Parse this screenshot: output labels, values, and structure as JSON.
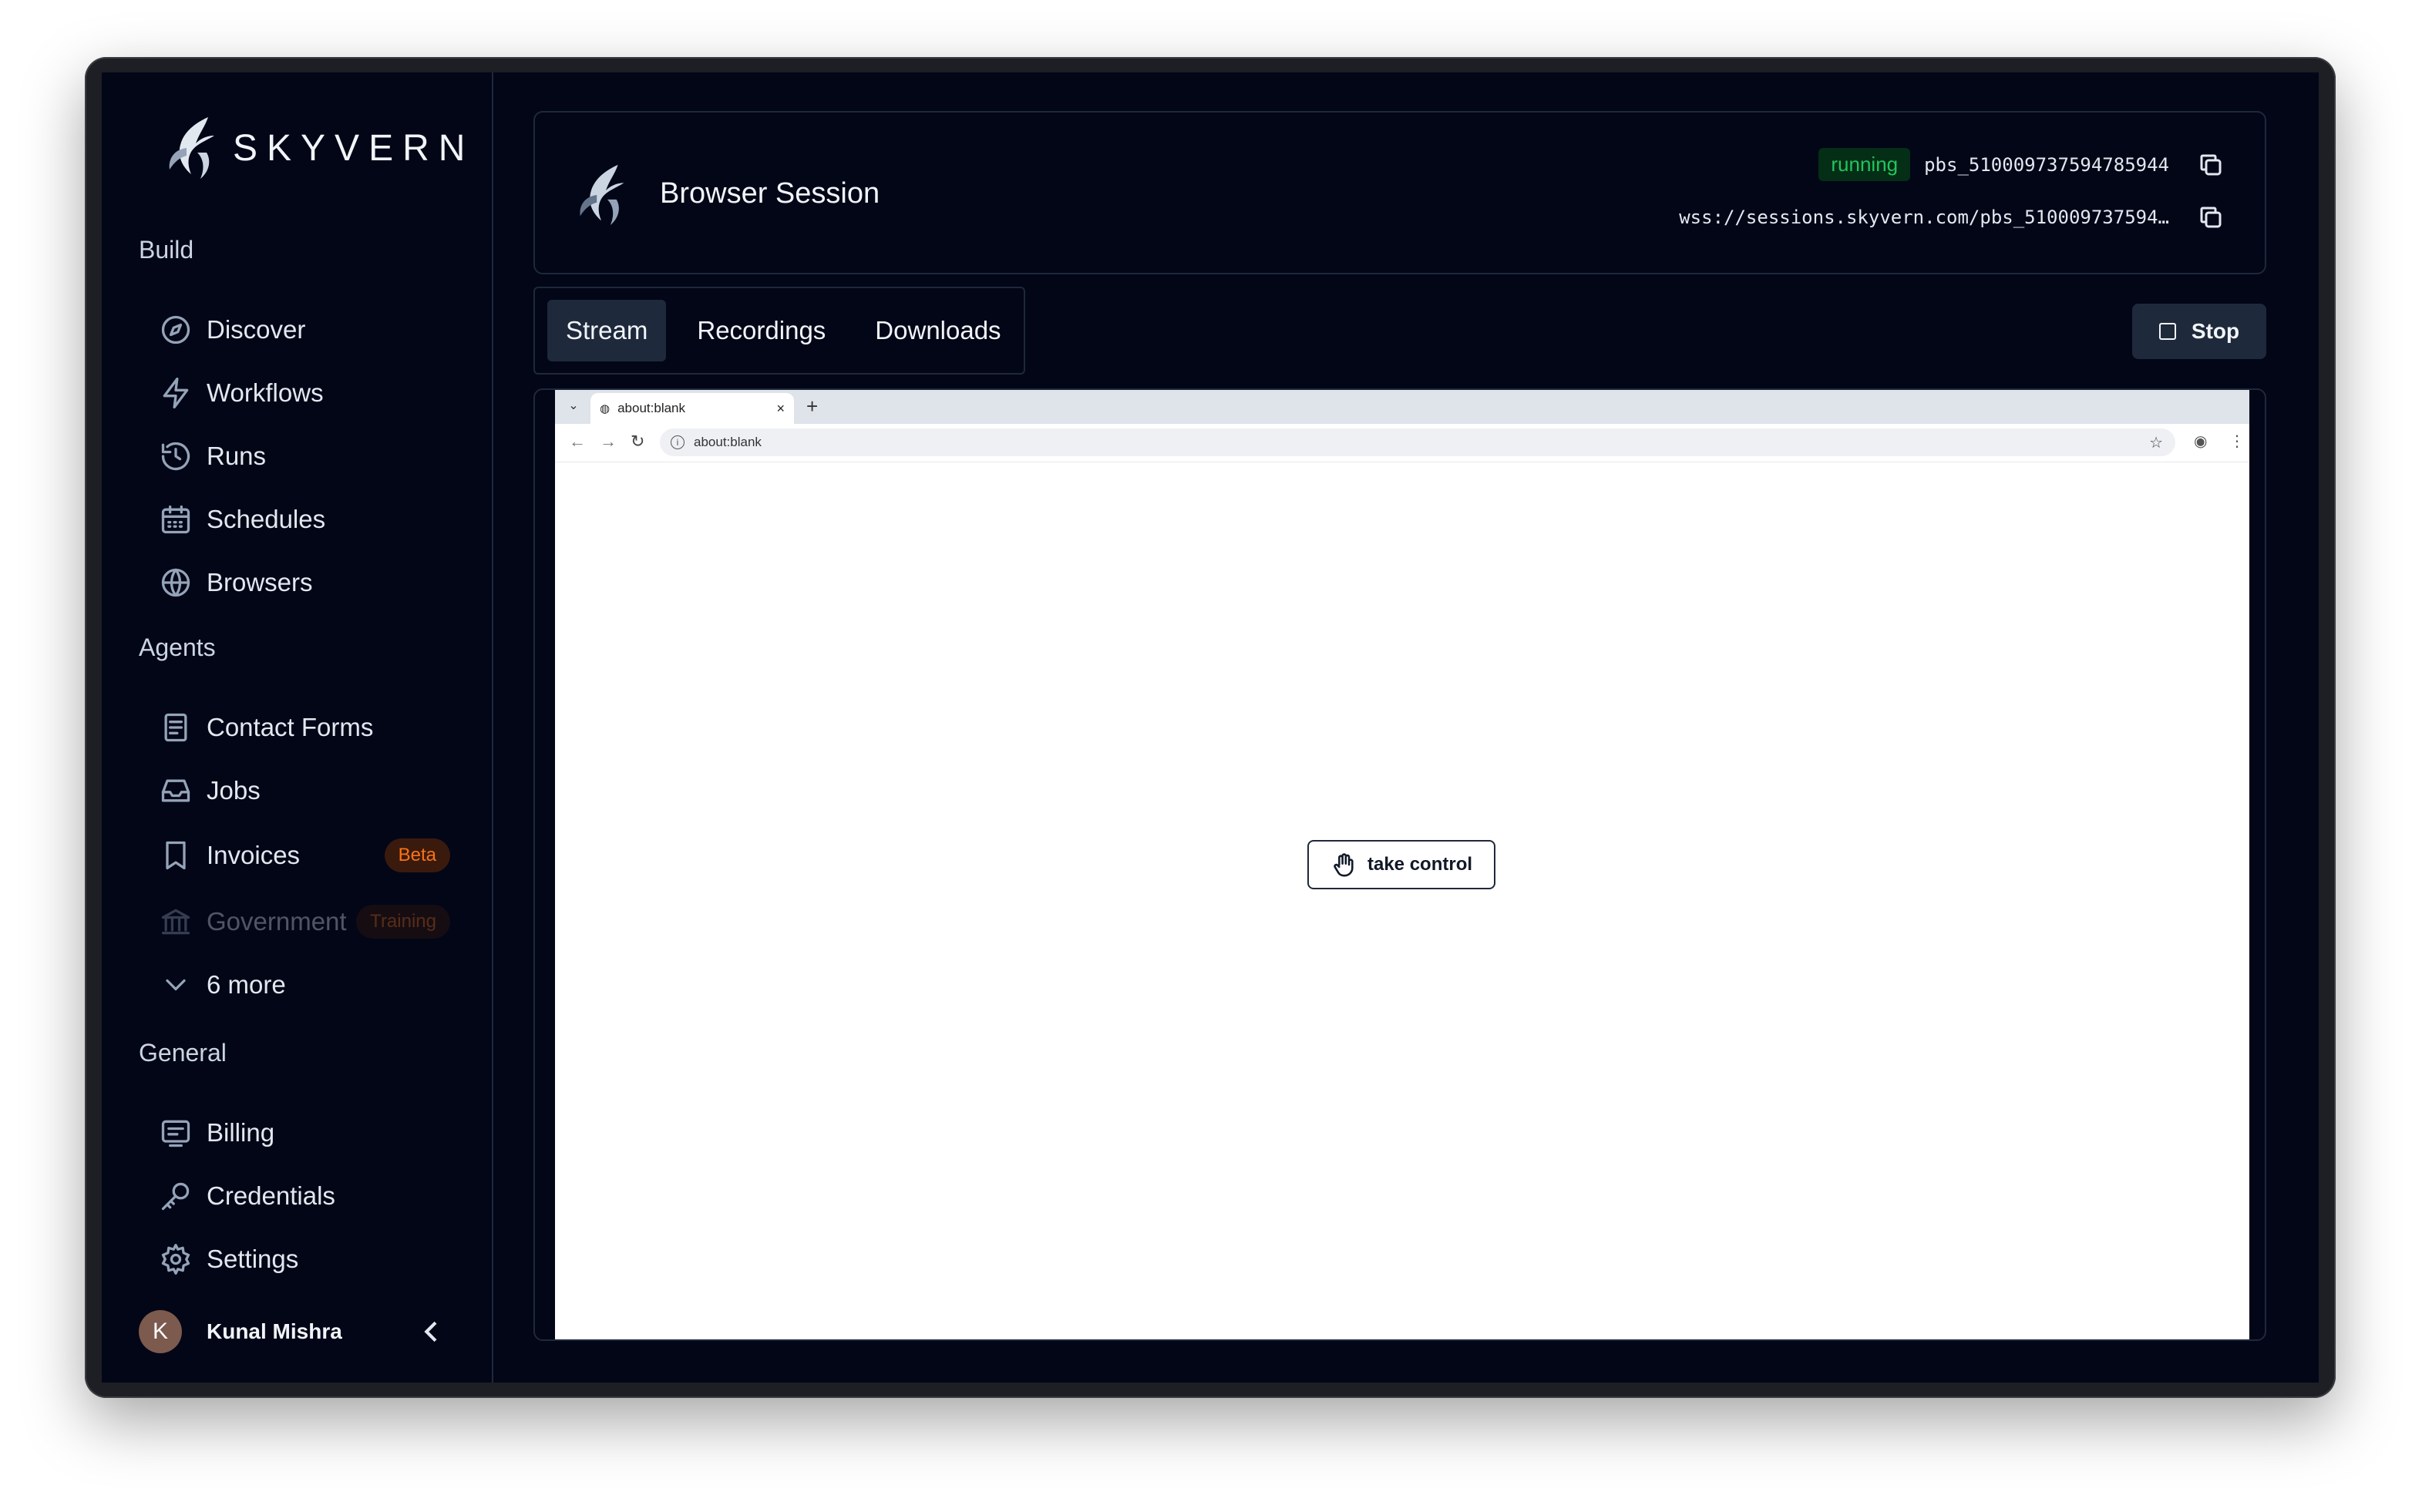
{
  "brand": {
    "name": "SKYVERN"
  },
  "sidebar": {
    "sections": [
      {
        "title": "Build",
        "items": [
          {
            "label": "Discover",
            "icon": "compass-icon"
          },
          {
            "label": "Workflows",
            "icon": "lightning-icon"
          },
          {
            "label": "Runs",
            "icon": "history-icon"
          },
          {
            "label": "Schedules",
            "icon": "calendar-icon"
          },
          {
            "label": "Browsers",
            "icon": "globe-icon"
          }
        ]
      },
      {
        "title": "Agents",
        "items": [
          {
            "label": "Contact Forms",
            "icon": "document-icon"
          },
          {
            "label": "Jobs",
            "icon": "inbox-icon"
          },
          {
            "label": "Invoices",
            "icon": "bookmark-icon",
            "badge": "Beta"
          },
          {
            "label": "Government",
            "icon": "bank-icon",
            "badge": "Training"
          },
          {
            "label": "6 more",
            "icon": "chevron-down-icon"
          }
        ]
      },
      {
        "title": "General",
        "items": [
          {
            "label": "Billing",
            "icon": "billing-icon"
          },
          {
            "label": "Credentials",
            "icon": "key-icon"
          },
          {
            "label": "Settings",
            "icon": "gear-icon"
          }
        ]
      }
    ],
    "user": {
      "initial": "K",
      "name": "Kunal Mishra"
    }
  },
  "session": {
    "title": "Browser Session",
    "status": "running",
    "id": "pbs_510009737594785944",
    "ws_url": "wss://sessions.skyvern.com/pbs_510009737594…"
  },
  "tabs": [
    {
      "label": "Stream",
      "active": true
    },
    {
      "label": "Recordings",
      "active": false
    },
    {
      "label": "Downloads",
      "active": false
    }
  ],
  "stop_label": "Stop",
  "stream": {
    "tab_title": "about:blank",
    "url": "about:blank",
    "take_control_label": "take control"
  },
  "colors": {
    "background": "#020617",
    "status_green": "#22c55e",
    "badge_orange": "#f97316"
  }
}
